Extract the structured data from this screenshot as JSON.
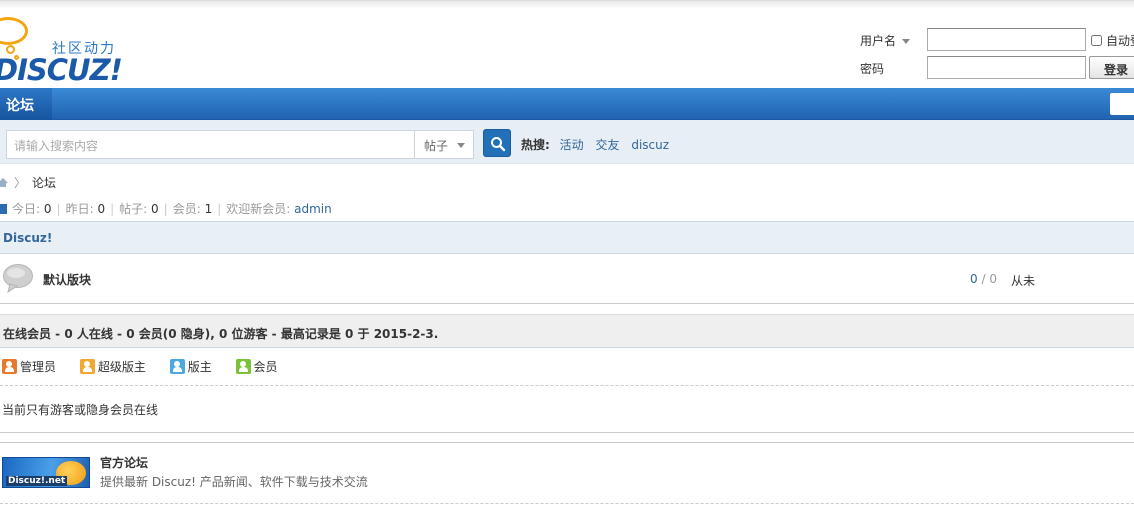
{
  "header": {
    "logo_tagline": "社区动力",
    "logo_word": "DISCUZ!",
    "login": {
      "username_label": "用户名",
      "password_label": "密码",
      "username_value": "",
      "password_value": "",
      "remember_label": "自动登",
      "login_button": "登录"
    }
  },
  "nav": {
    "forum_tab": "论坛"
  },
  "search": {
    "placeholder": "请输入搜索内容",
    "type_selected": "帖子",
    "hot_label": "热搜:",
    "hot_terms": [
      "活动",
      "交友",
      "discuz"
    ]
  },
  "breadcrumb": {
    "current": "论坛"
  },
  "stats": {
    "today_label": "今日:",
    "today": "0",
    "yesterday_label": "昨日:",
    "yesterday": "0",
    "posts_label": "帖子:",
    "posts": "0",
    "members_label": "会员:",
    "members": "1",
    "welcome_label": "欢迎新会员:",
    "newest_member": "admin"
  },
  "category": {
    "title": "Discuz!",
    "forums": [
      {
        "name": "默认版块",
        "threads": "0",
        "posts": "0",
        "last_post": "从未"
      }
    ]
  },
  "online": {
    "summary": "在线会员 - 0 人在线 - 0 会员(0 隐身), 0 位游客 - 最高记录是 0 于 2015-2-3.",
    "legend": [
      {
        "label": "管理员",
        "color": "#e8782c"
      },
      {
        "label": "超级版主",
        "color": "#f0a830"
      },
      {
        "label": "版主",
        "color": "#4ea8e0"
      },
      {
        "label": "会员",
        "color": "#7cc13a"
      }
    ],
    "empty_message": "当前只有游客或隐身会员在线"
  },
  "links": {
    "official": {
      "logo_text": "Discuz!.net",
      "title": "官方论坛",
      "description": "提供最新 Discuz! 产品新闻、软件下载与技术交流"
    }
  }
}
